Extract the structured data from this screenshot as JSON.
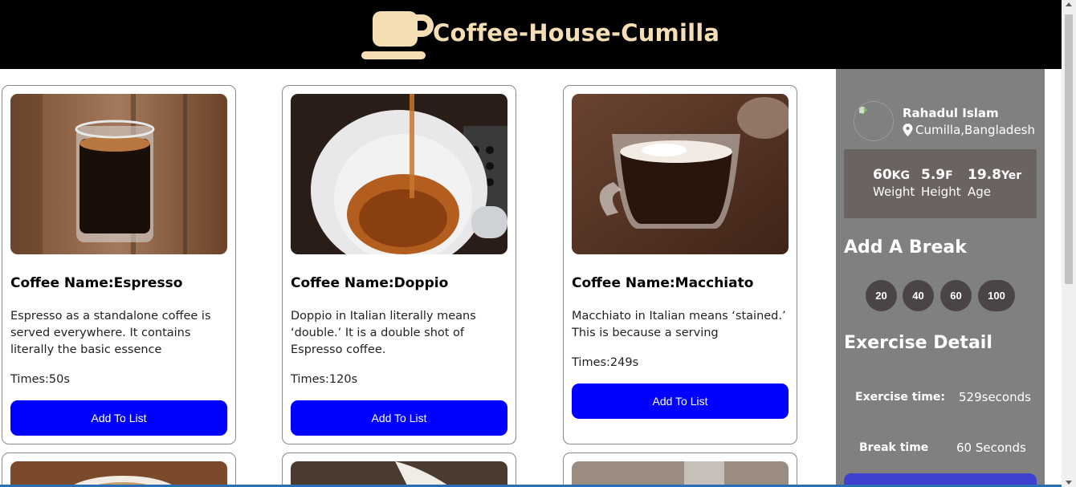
{
  "header": {
    "title": "Coffee-House-Cumilla",
    "logo_icon": "coffee-cup-icon",
    "logo_color": "#f5deb3"
  },
  "cards": [
    {
      "name": "Coffee Name:Espresso",
      "description": "Espresso as a standalone coffee is served everywhere. It contains literally the basic essence",
      "time": "Times:50s",
      "button": "Add To List"
    },
    {
      "name": "Coffee Name:Doppio",
      "description": "Doppio in Italian literally means ‘double.’ It is a double shot of Espresso coffee.",
      "time": "Times:120s",
      "button": "Add To List"
    },
    {
      "name": "Coffee Name:Macchiato",
      "description": "Macchiato in Italian means ‘stained.’ This is because a serving",
      "time": "Times:249s",
      "button": "Add To List"
    }
  ],
  "profile": {
    "name": "Rahadul Islam",
    "location": "Cumilla,Bangladesh",
    "stats": [
      {
        "value": "60",
        "unit": "KG",
        "label": "Weight"
      },
      {
        "value": "5.9",
        "unit": "F",
        "label": "Height"
      },
      {
        "value": "19.8",
        "unit": "Yer",
        "label": "Age"
      }
    ]
  },
  "break": {
    "title": "Add A Break",
    "options": [
      "20",
      "40",
      "60",
      "100"
    ]
  },
  "exercise": {
    "title": "Exercise Detail",
    "exercise_time_label": "Exercise time:",
    "exercise_time_value": "529seconds",
    "break_time_label": "Break time",
    "break_time_value": "60 Seconds"
  },
  "colors": {
    "accent": "#0000ff",
    "sidebar": "#808080",
    "stats_bg": "#6b6262",
    "break_btn": "#4a4444"
  }
}
